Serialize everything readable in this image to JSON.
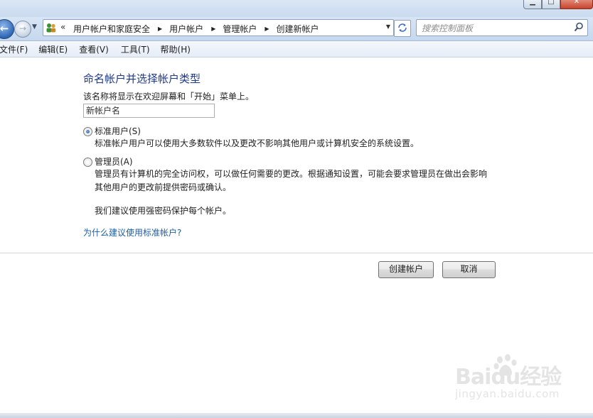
{
  "address_bar": {
    "crumbs": [
      "用户帐户和家庭安全",
      "用户帐户",
      "管理帐户",
      "创建新帐户"
    ]
  },
  "search": {
    "placeholder": "搜索控制面板"
  },
  "menu": [
    "文件(F)",
    "编辑(E)",
    "查看(V)",
    "工具(T)",
    "帮助(H)"
  ],
  "form": {
    "heading": "命名帐户并选择帐户类型",
    "description": "该名称将显示在欢迎屏幕和「开始」菜单上。",
    "name_value": "新帐户名",
    "standard_label": "标准用户(S)",
    "standard_desc": "标准帐户用户可以使用大多数软件以及更改不影响其他用户或计算机安全的系统设置。",
    "admin_label": "管理员(A)",
    "admin_desc_line1": "管理员有计算机的完全访问权，可以做任何需要的更改。根据通知设置，可能会要求管理员在做出会影响",
    "admin_desc_line2": "其他用户的更改前提供密码或确认。",
    "recommend": "我们建议使用强密码保护每个帐户。",
    "why_link": "为什么建议使用标准帐户?",
    "selected": "standard"
  },
  "buttons": {
    "create": "创建帐户",
    "cancel": "取消"
  },
  "watermark": {
    "logo": "Baidu经验",
    "url": "jingyan.baidu.com"
  },
  "colors": {
    "heading": "#1e3a8a",
    "link": "#1b5ea8",
    "nav_bg": "#d8e5f4"
  }
}
